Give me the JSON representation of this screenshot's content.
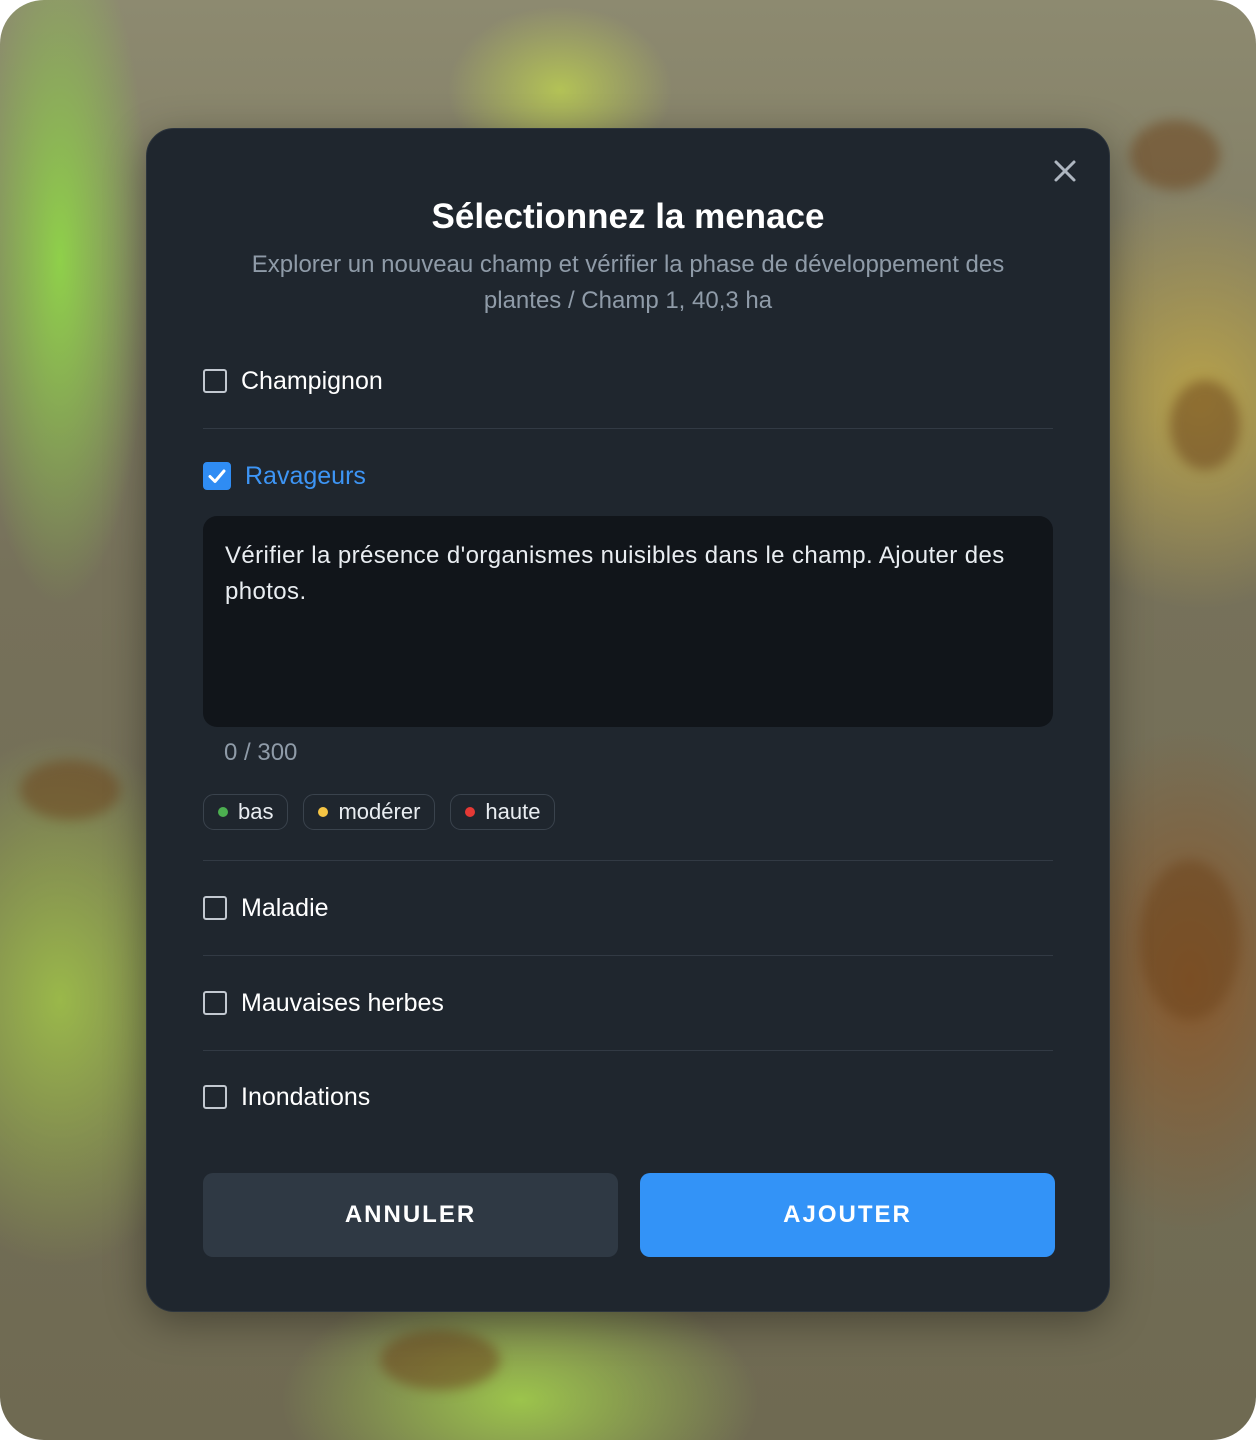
{
  "colors": {
    "modal_bg": "#1f262e",
    "accent": "#2f8cf3",
    "textarea_bg": "#11151a",
    "severity_low": "#4caf50",
    "severity_moderate": "#f6c544",
    "severity_high": "#e53935"
  },
  "dialog": {
    "close_icon": "close-icon",
    "title": "Sélectionnez la menace",
    "subtitle": "Explorer un nouveau champ et vérifier la phase de développement des plantes / Champ 1, 40,3 ha"
  },
  "options": [
    {
      "label": "Champignon",
      "checked": false
    },
    {
      "label": "Ravageurs",
      "checked": true
    },
    {
      "label": "Maladie",
      "checked": false
    },
    {
      "label": "Mauvaises herbes",
      "checked": false
    },
    {
      "label": "Inondations",
      "checked": false
    }
  ],
  "ravageurs_panel": {
    "note_text": "Vérifier la présence d'organismes nuisibles dans le champ. Ajouter des photos.",
    "counter": "0 / 300",
    "severity_chips": [
      {
        "label": "bas",
        "color": "#4caf50"
      },
      {
        "label": "modérer",
        "color": "#f6c544"
      },
      {
        "label": "haute",
        "color": "#e53935"
      }
    ]
  },
  "actions": {
    "cancel_label": "ANNULER",
    "add_label": "AJOUTER"
  }
}
